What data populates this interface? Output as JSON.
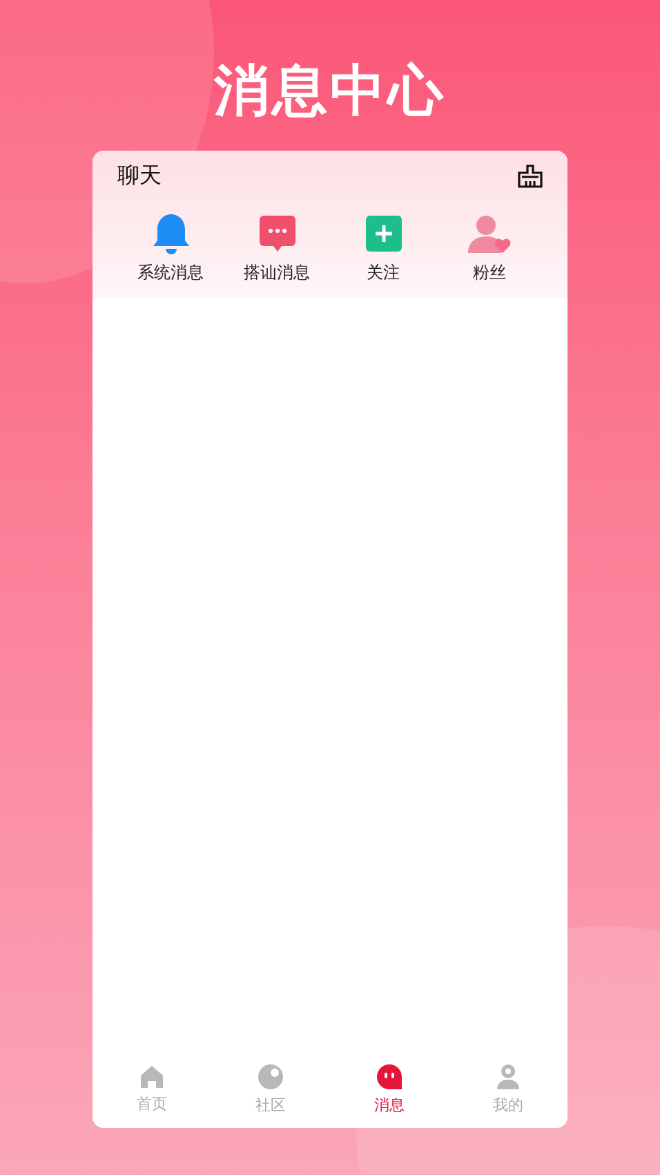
{
  "page_title": "消息中心",
  "card": {
    "title": "聊天",
    "shortcuts": [
      {
        "kind": "bell",
        "label": "系统消息"
      },
      {
        "kind": "chat",
        "label": "搭讪消息"
      },
      {
        "kind": "plus",
        "label": "关注"
      },
      {
        "kind": "fans",
        "label": "粉丝"
      }
    ]
  },
  "tab_bar": [
    {
      "kind": "home",
      "label": "首页",
      "selected": false
    },
    {
      "kind": "community",
      "label": "社区",
      "selected": false
    },
    {
      "kind": "message",
      "label": "消息",
      "selected": true
    },
    {
      "kind": "profile",
      "label": "我的",
      "selected": false
    }
  ]
}
